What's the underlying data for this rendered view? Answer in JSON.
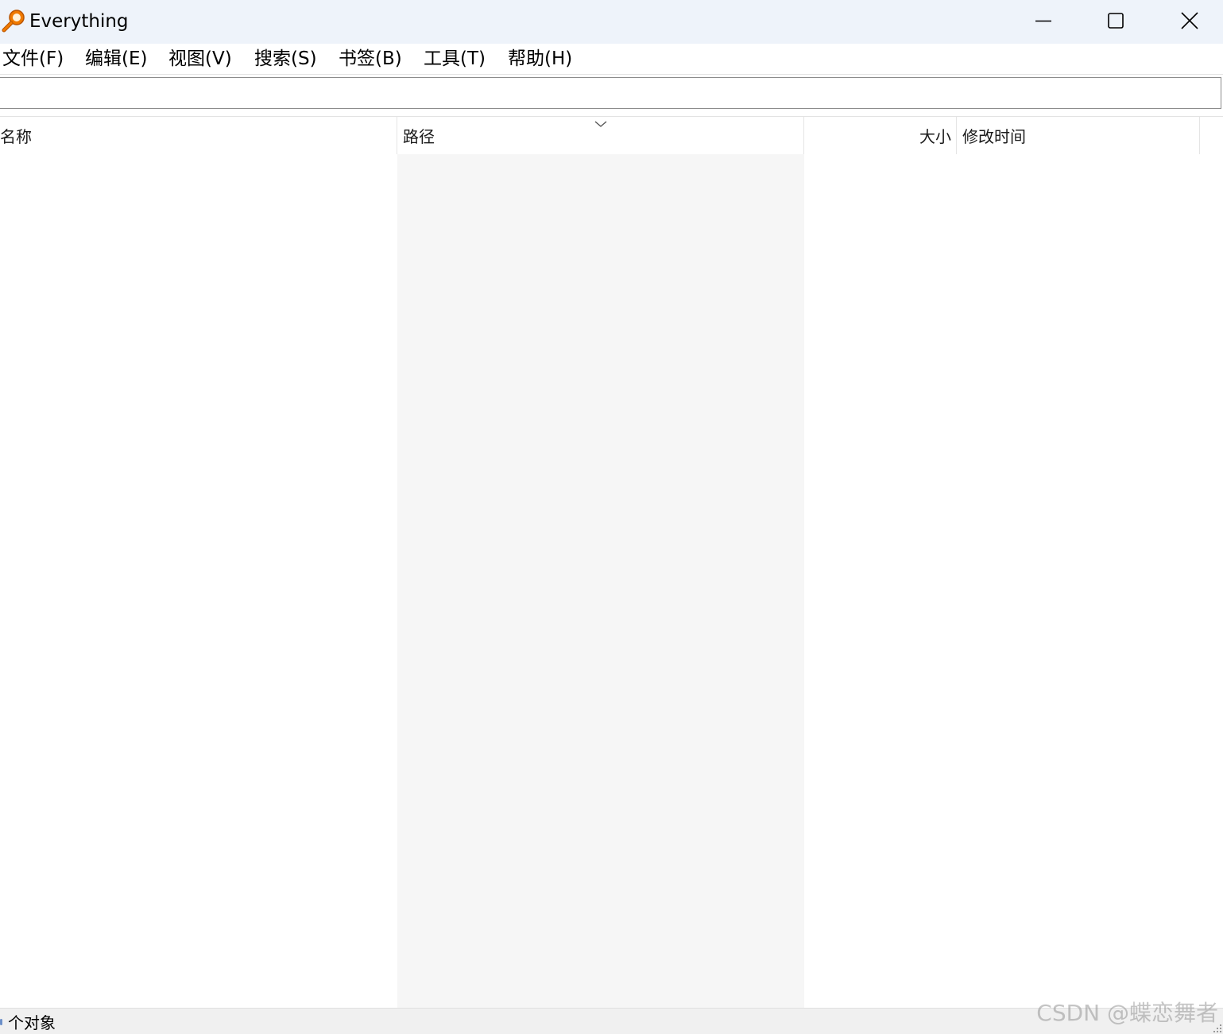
{
  "window": {
    "title": "Everything",
    "icon": "magnifier-icon"
  },
  "controls": {
    "minimize": "minimize-icon",
    "maximize": "maximize-icon",
    "close": "close-icon"
  },
  "menu": {
    "items": [
      {
        "label": "文件(F)"
      },
      {
        "label": "编辑(E)"
      },
      {
        "label": "视图(V)"
      },
      {
        "label": "搜索(S)"
      },
      {
        "label": "书签(B)"
      },
      {
        "label": "工具(T)"
      },
      {
        "label": "帮助(H)"
      }
    ]
  },
  "search": {
    "value": ""
  },
  "columns": {
    "name": "名称",
    "path": "路径",
    "size": "大小",
    "modified": "修改时间",
    "sorted_by": "path",
    "sort_icon": "chevron-down-icon"
  },
  "results": [],
  "status": {
    "text": "个对象"
  },
  "watermark": "CSDN @蝶恋舞者",
  "colors": {
    "titlebar": "#eef3fa",
    "path_column": "#f6f6f6",
    "statusbar": "#f0f0f0",
    "icon_orange": "#f07a00"
  }
}
